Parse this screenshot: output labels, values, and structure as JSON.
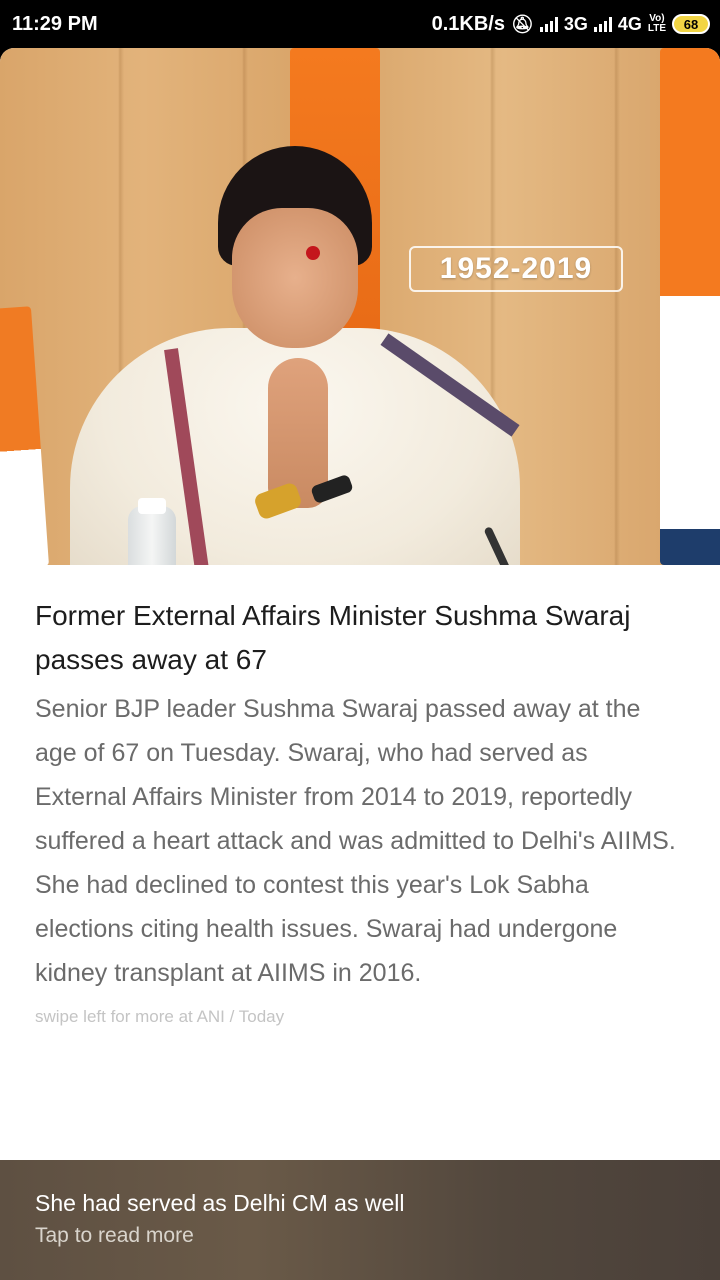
{
  "status_bar": {
    "time": "11:29 PM",
    "speed": "0.1KB/s",
    "net1": "3G",
    "net2": "4G",
    "volte_top": "Vo)",
    "volte_bottom": "LTE",
    "battery": "68",
    "mute_icon": "bell-off-icon"
  },
  "hero": {
    "years": "1952-2019"
  },
  "article": {
    "headline": "Former External Affairs Minister Sushma Swaraj passes away at 67",
    "body": "Senior BJP leader Sushma Swaraj passed away at the age of 67 on Tuesday. Swaraj, who had served as External Affairs Minister from 2014 to 2019, reportedly suffered a heart attack and was admitted to Delhi's AIIMS. She had declined to contest this year's Lok Sabha elections citing health issues. Swaraj had undergone kidney transplant at AIIMS in 2016.",
    "source": "swipe left for more at ANI / Today"
  },
  "bottom_bar": {
    "teaser": "She had served as Delhi CM as well",
    "cta": "Tap to read more"
  }
}
